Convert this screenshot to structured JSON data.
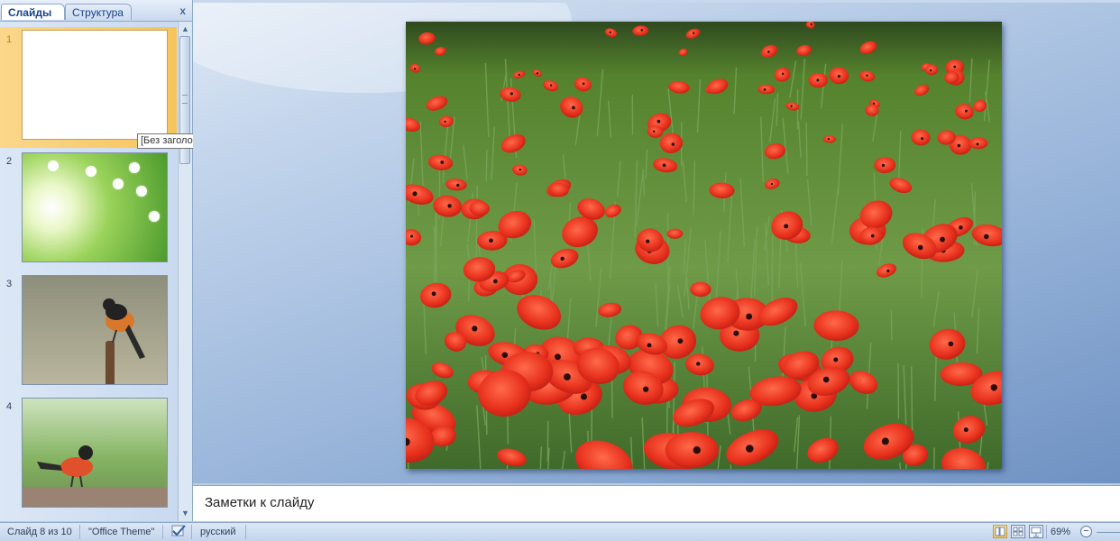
{
  "slides_pane": {
    "tabs": [
      {
        "label": "Слайды",
        "selected": true
      },
      {
        "label": "Структура",
        "selected": false
      }
    ],
    "close_glyph": "x",
    "thumbnails": [
      {
        "number": "1",
        "selected": true
      },
      {
        "number": "2"
      },
      {
        "number": "3"
      },
      {
        "number": "4"
      }
    ],
    "tooltip": "[Без заголовка]"
  },
  "notes": {
    "placeholder": "Заметки к слайду"
  },
  "status_bar": {
    "slide_info": "Слайд 8 из 10",
    "theme": "\"Office Theme\"",
    "language": "русский",
    "zoom": "69%",
    "zoom_out_glyph": "−"
  },
  "colors": {
    "accent": "#f6c45b",
    "pane_bg": "#c4d6ee",
    "editor_bg": "#99b5da"
  },
  "icons": {
    "close": "close-icon",
    "spell_check": "spell-check-icon",
    "normal_view": "normal-view-icon",
    "slide_sorter": "slide-sorter-icon",
    "slideshow": "slideshow-icon",
    "zoom_out": "zoom-out-icon"
  }
}
